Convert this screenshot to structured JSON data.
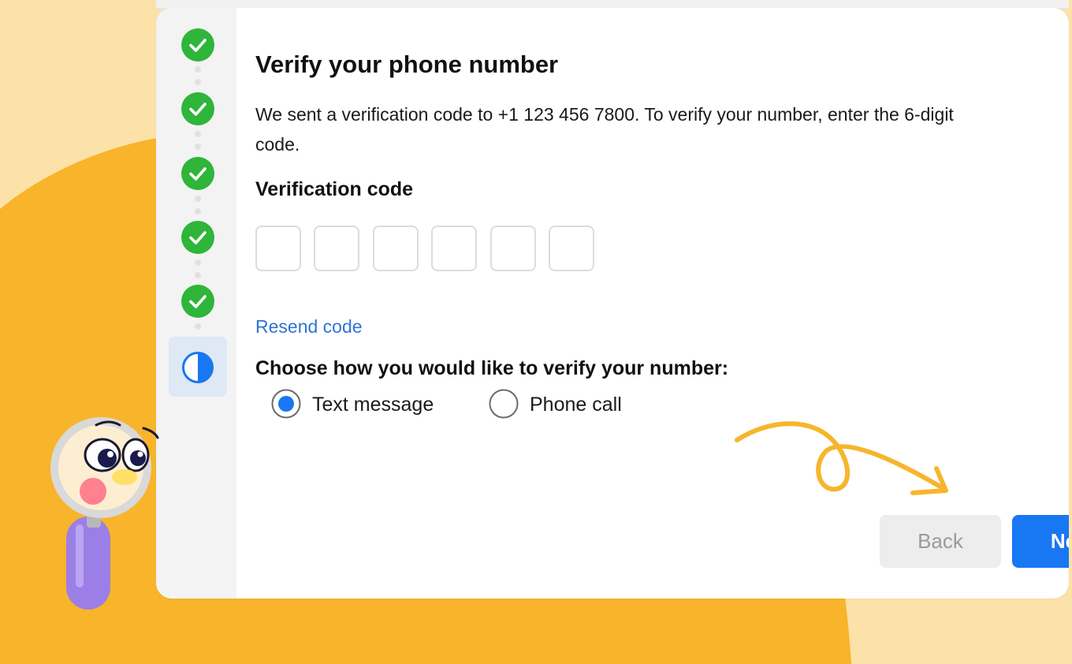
{
  "colors": {
    "background_light": "#fce2a8",
    "background_blob": "#f8b42b",
    "check_green": "#2fb53a",
    "accent_blue": "#1877f2",
    "link_blue": "#2f74d0",
    "arrow_yellow": "#f7b52c"
  },
  "stepper": {
    "steps": [
      {
        "status": "completed",
        "icon": "check-circle-icon"
      },
      {
        "status": "completed",
        "icon": "check-circle-icon"
      },
      {
        "status": "completed",
        "icon": "check-circle-icon"
      },
      {
        "status": "completed",
        "icon": "check-circle-icon"
      },
      {
        "status": "completed",
        "icon": "check-circle-icon"
      },
      {
        "status": "current",
        "icon": "half-circle-progress-icon"
      }
    ]
  },
  "form": {
    "title": "Verify your phone number",
    "description": "We sent a verification code to +1 123 456 7800. To verify your number, enter the 6-digit code.",
    "code_label": "Verification code",
    "code_digits": [
      "",
      "",
      "",
      "",
      "",
      ""
    ],
    "resend_label": "Resend code",
    "method_question": "Choose how you would like to verify your number:",
    "methods": [
      {
        "label": "Text message",
        "selected": true
      },
      {
        "label": "Phone call",
        "selected": false
      }
    ]
  },
  "actions": {
    "back_label": "Back",
    "back_enabled": false,
    "next_label": "Next"
  }
}
